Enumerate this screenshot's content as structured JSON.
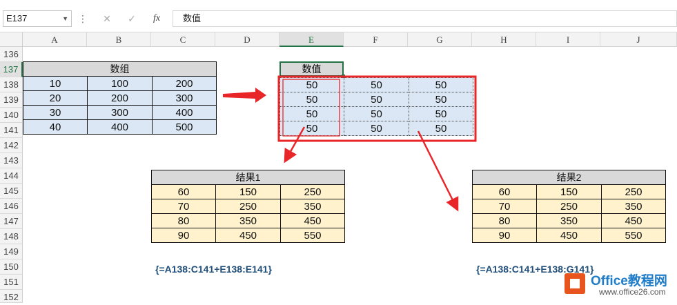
{
  "toolbar": {
    "name_box": "E137",
    "cancel_icon": "✕",
    "enter_icon": "✓",
    "fx_label": "fx",
    "formula_value": "数值"
  },
  "columns": [
    "A",
    "B",
    "C",
    "D",
    "E",
    "F",
    "G",
    "H",
    "I",
    "J"
  ],
  "active_column": "E",
  "rows": [
    "136",
    "137",
    "138",
    "139",
    "140",
    "141",
    "142",
    "143",
    "144",
    "145",
    "146",
    "147",
    "148",
    "149",
    "150",
    "151",
    "152"
  ],
  "active_row": "137",
  "array_table": {
    "header": "数组",
    "rows": [
      [
        "10",
        "100",
        "200"
      ],
      [
        "20",
        "200",
        "300"
      ],
      [
        "30",
        "300",
        "400"
      ],
      [
        "40",
        "400",
        "500"
      ]
    ]
  },
  "value_table": {
    "header": "数值",
    "rows": [
      [
        "50",
        "50",
        "50"
      ],
      [
        "50",
        "50",
        "50"
      ],
      [
        "50",
        "50",
        "50"
      ],
      [
        "50",
        "50",
        "50"
      ]
    ]
  },
  "result1": {
    "header": "结果1",
    "rows": [
      [
        "60",
        "150",
        "250"
      ],
      [
        "70",
        "250",
        "350"
      ],
      [
        "80",
        "350",
        "450"
      ],
      [
        "90",
        "450",
        "550"
      ]
    ],
    "formula": "{=A138:C141+E138:E141}"
  },
  "result2": {
    "header": "结果2",
    "rows": [
      [
        "60",
        "150",
        "250"
      ],
      [
        "70",
        "250",
        "350"
      ],
      [
        "80",
        "350",
        "450"
      ],
      [
        "90",
        "450",
        "550"
      ]
    ],
    "formula": "{=A138:C141+E138:G141}"
  },
  "watermark": {
    "brand": "Office教程网",
    "url": "www.office26.com"
  },
  "colors": {
    "accent": "#217346",
    "arrow": "#e8262a",
    "blue_fill": "#dbe7f4",
    "yellow_fill": "#fff2cc",
    "header_fill": "#d9d9d9"
  }
}
